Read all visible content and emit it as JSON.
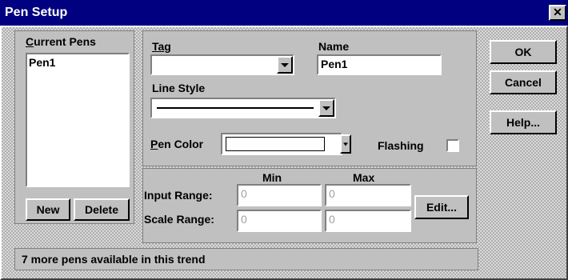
{
  "window": {
    "title": "Pen Setup",
    "close_glyph": "✕"
  },
  "current_pens": {
    "label_accel": "C",
    "label_rest": "urrent Pens",
    "items": [
      "Pen1"
    ],
    "new_label": "New",
    "delete_label": "Delete"
  },
  "tag": {
    "label": "Tag",
    "value": ""
  },
  "name": {
    "label": "Name",
    "value": "Pen1"
  },
  "line_style": {
    "label": "Line Style"
  },
  "pen_color": {
    "label_accel": "P",
    "label_rest": "en Color",
    "value": "#ffffff"
  },
  "flashing": {
    "label": "Flashing",
    "checked": false
  },
  "range": {
    "min_header": "Min",
    "max_header": "Max",
    "input_label": "Input Range:",
    "scale_label": "Scale Range:",
    "input_min": "0",
    "input_max": "0",
    "scale_min": "0",
    "scale_max": "0",
    "edit_label": "Edit..."
  },
  "buttons": {
    "ok": "OK",
    "cancel": "Cancel",
    "help": "Help..."
  },
  "status": "7 more pens available in this trend"
}
